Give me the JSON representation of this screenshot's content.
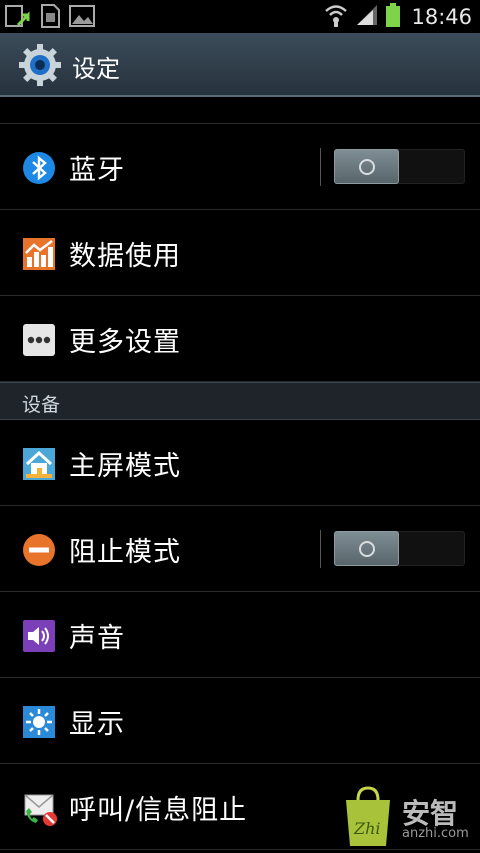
{
  "status_bar": {
    "time": "18:46",
    "icons": [
      "upload-notification-icon",
      "sim-card-icon",
      "image-icon",
      "wifi-icon",
      "signal-icon",
      "battery-icon"
    ]
  },
  "action_bar": {
    "title": "设定",
    "icon": "settings-gear-icon"
  },
  "items": [
    {
      "label": "蓝牙",
      "icon": "bluetooth-icon",
      "toggle": "off"
    },
    {
      "label": "数据使用",
      "icon": "data-usage-icon"
    },
    {
      "label": "更多设置",
      "icon": "more-dots-icon"
    }
  ],
  "section": {
    "label": "设备"
  },
  "device_items": [
    {
      "label": "主屏模式",
      "icon": "home-screen-icon"
    },
    {
      "label": "阻止模式",
      "icon": "block-mode-icon",
      "toggle": "off"
    },
    {
      "label": "声音",
      "icon": "sound-icon"
    },
    {
      "label": "显示",
      "icon": "display-brightness-icon"
    },
    {
      "label": "呼叫/信息阻止",
      "icon": "call-message-block-icon"
    }
  ],
  "watermark": {
    "text": "安智",
    "sub": "anzhi.com",
    "badge": "Zhi"
  },
  "colors": {
    "actionbar": "#3c4c5a",
    "section_bg": "#1e2429",
    "bluetooth": "#1e88e5",
    "block": "#e8732a"
  }
}
